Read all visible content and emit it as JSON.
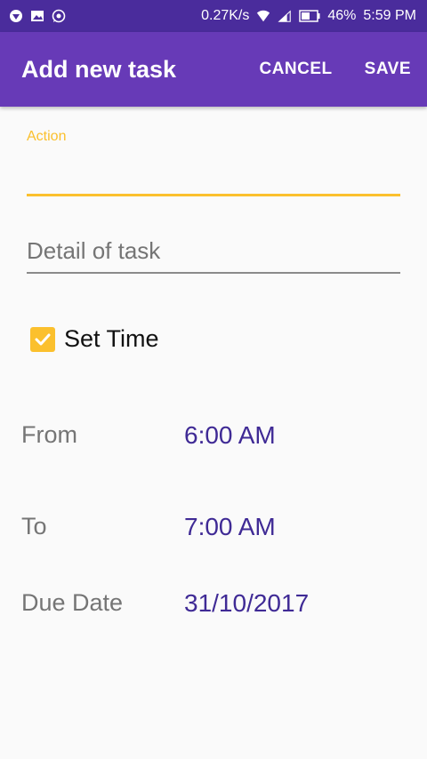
{
  "status_bar": {
    "speed": "0.27K/s",
    "battery": "46%",
    "time": "5:59 PM",
    "icons": [
      "notification-icon",
      "image-icon",
      "whatsapp-icon",
      "wifi-icon",
      "signal-icon",
      "battery-icon"
    ]
  },
  "app_bar": {
    "title": "Add new task",
    "cancel_label": "CANCEL",
    "save_label": "SAVE",
    "color": "#673ab7"
  },
  "form": {
    "action_label": "Action",
    "action_value": "",
    "detail_placeholder": "Detail of task",
    "detail_value": "",
    "set_time_label": "Set Time",
    "set_time_checked": true,
    "from_label": "From",
    "from_value": "6:00 AM",
    "to_label": "To",
    "to_value": "7:00 AM",
    "due_label": "Due Date",
    "due_value": "31/10/2017",
    "accent": "#fbc02d",
    "value_color": "#3f2a95"
  }
}
